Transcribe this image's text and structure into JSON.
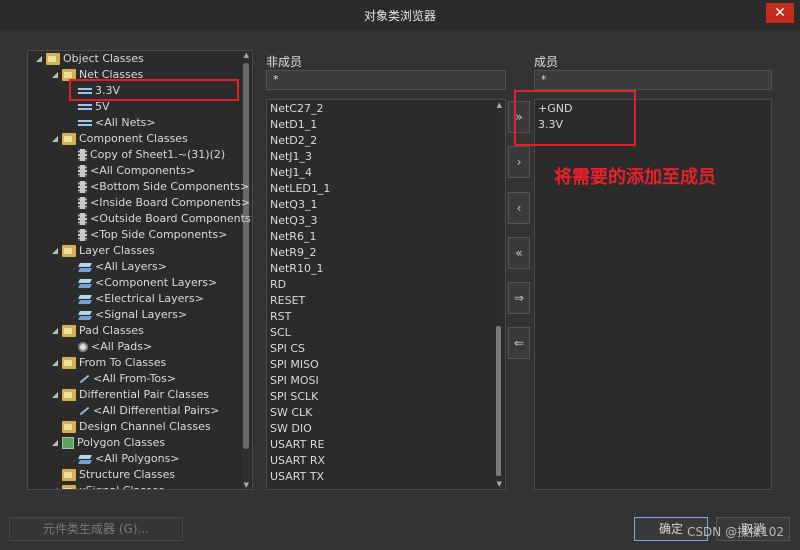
{
  "window": {
    "title": "对象类浏览器",
    "close_glyph": "✕"
  },
  "tree": {
    "items": [
      {
        "label": "Object Classes",
        "level": 0,
        "expander": "◢",
        "icon": "folder-icon"
      },
      {
        "label": "Net Classes",
        "level": 1,
        "expander": "◢",
        "icon": "folder-icon"
      },
      {
        "label": "3.3V",
        "level": 2,
        "expander": "",
        "icon": "net-icon"
      },
      {
        "label": "5V",
        "level": 2,
        "expander": "",
        "icon": "net-icon"
      },
      {
        "label": "<All Nets>",
        "level": 2,
        "expander": "",
        "icon": "net-icon"
      },
      {
        "label": "Component Classes",
        "level": 1,
        "expander": "◢",
        "icon": "folder-icon"
      },
      {
        "label": "Copy of Sheet1.~(31)(2)",
        "level": 2,
        "expander": "",
        "icon": "component-icon"
      },
      {
        "label": "<All Components>",
        "level": 2,
        "expander": "",
        "icon": "component-icon"
      },
      {
        "label": "<Bottom Side Components>",
        "level": 2,
        "expander": "",
        "icon": "component-icon"
      },
      {
        "label": "<Inside Board Components>",
        "level": 2,
        "expander": "",
        "icon": "component-icon"
      },
      {
        "label": "<Outside Board Components>",
        "level": 2,
        "expander": "",
        "icon": "component-icon"
      },
      {
        "label": "<Top Side Components>",
        "level": 2,
        "expander": "",
        "icon": "component-icon"
      },
      {
        "label": "Layer Classes",
        "level": 1,
        "expander": "◢",
        "icon": "folder-icon"
      },
      {
        "label": "<All Layers>",
        "level": 2,
        "expander": "",
        "icon": "layer-icon"
      },
      {
        "label": "<Component Layers>",
        "level": 2,
        "expander": "",
        "icon": "layer-icon"
      },
      {
        "label": "<Electrical Layers>",
        "level": 2,
        "expander": "",
        "icon": "layer-icon"
      },
      {
        "label": "<Signal Layers>",
        "level": 2,
        "expander": "",
        "icon": "layer-icon"
      },
      {
        "label": "Pad Classes",
        "level": 1,
        "expander": "◢",
        "icon": "folder-icon"
      },
      {
        "label": "<All Pads>",
        "level": 2,
        "expander": "",
        "icon": "pad-icon"
      },
      {
        "label": "From To Classes",
        "level": 1,
        "expander": "◢",
        "icon": "folder-icon"
      },
      {
        "label": "<All From-Tos>",
        "level": 2,
        "expander": "",
        "icon": "from-to-icon"
      },
      {
        "label": "Differential Pair Classes",
        "level": 1,
        "expander": "◢",
        "icon": "folder-icon"
      },
      {
        "label": "<All Differential Pairs>",
        "level": 2,
        "expander": "",
        "icon": "diff-pair-icon"
      },
      {
        "label": "Design Channel Classes",
        "level": 1,
        "expander": "",
        "icon": "folder-icon"
      },
      {
        "label": "Polygon Classes",
        "level": 1,
        "expander": "◢",
        "icon": "polygon-icon"
      },
      {
        "label": "<All Polygons>",
        "level": 2,
        "expander": "",
        "icon": "layer-icon"
      },
      {
        "label": "Structure Classes",
        "level": 1,
        "expander": "",
        "icon": "folder-icon"
      },
      {
        "label": "xSignal Classes",
        "level": 1,
        "expander": "◢",
        "icon": "folder-icon"
      }
    ]
  },
  "non_members": {
    "label": "非成员",
    "filter": "*",
    "items": [
      "NetC27_2",
      "NetD1_1",
      "NetD2_2",
      "NetJ1_3",
      "NetJ1_4",
      "NetLED1_1",
      "NetQ3_1",
      "NetQ3_3",
      "NetR6_1",
      "NetR9_2",
      "NetR10_1",
      "RD",
      "RESET",
      "RST",
      "SCL",
      "SPI CS",
      "SPI MISO",
      "SPI MOSI",
      "SPI SCLK",
      "SW CLK",
      "SW DIO",
      "USART RE",
      "USART RX",
      "USART TX"
    ]
  },
  "members": {
    "label": "成员",
    "filter": "*",
    "items": [
      "+GND",
      "3.3V"
    ]
  },
  "move_buttons": [
    {
      "glyph": "»",
      "name": "add-all-button"
    },
    {
      "glyph": "›",
      "name": "add-selected-button"
    },
    {
      "glyph": "‹",
      "name": "remove-selected-button"
    },
    {
      "glyph": "«",
      "name": "remove-all-button"
    },
    {
      "glyph": "⇒",
      "name": "add-matching-button"
    },
    {
      "glyph": "⇐",
      "name": "remove-matching-button"
    }
  ],
  "annotation": "将需要的添加至成员",
  "footer": {
    "generator_label": "元件类生成器 (G)...",
    "ok_label": "确定",
    "cancel_label": "取消",
    "watermark": "CSDN @揉揉102"
  },
  "colors": {
    "accent_red": "#e0202a",
    "primary_border": "#7aa7e0"
  }
}
